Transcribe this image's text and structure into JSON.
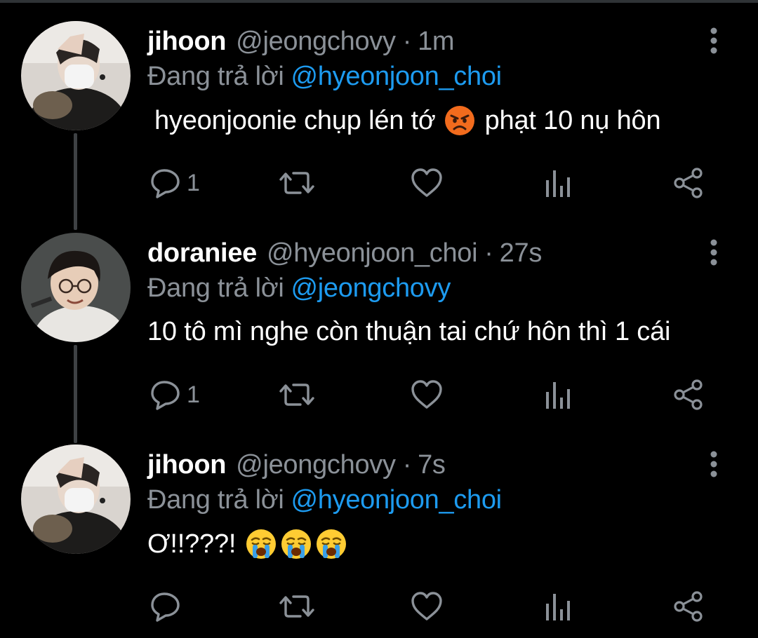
{
  "colors": {
    "background": "#000000",
    "name": "#ffffff",
    "muted": "#8b9198",
    "link": "#1d9bf0",
    "thread_line": "#3e4144"
  },
  "tweets": [
    {
      "avatar": "avatar-masked-person",
      "name": "jihoon",
      "handle": "@jeongchovy",
      "dot": "·",
      "time": "1m",
      "reply_prefix": "Đang trả lời",
      "reply_to": "@hyeonjoon_choi",
      "text_before": "hyeonjoonie chụp lén tớ",
      "emoji": [
        "angry-face-emoji"
      ],
      "text_after": "phạt 10 nụ hôn",
      "reply_count": "1",
      "icons": {
        "menu": "more-vertical-icon",
        "reply": "reply-icon",
        "retweet": "retweet-icon",
        "like": "like-icon",
        "views": "views-icon",
        "share": "share-icon"
      }
    },
    {
      "avatar": "avatar-glasses-person",
      "name": "doraniee",
      "handle": "@hyeonjoon_choi",
      "dot": "·",
      "time": "27s",
      "reply_prefix": "Đang trả lời",
      "reply_to": "@jeongchovy",
      "text_before": "10 tô mì nghe còn thuận tai chứ hôn thì 1 cái",
      "emoji": [],
      "text_after": "",
      "reply_count": "1",
      "icons": {
        "menu": "more-vertical-icon",
        "reply": "reply-icon",
        "retweet": "retweet-icon",
        "like": "like-icon",
        "views": "views-icon",
        "share": "share-icon"
      }
    },
    {
      "avatar": "avatar-masked-person",
      "name": "jihoon",
      "handle": "@jeongchovy",
      "dot": "·",
      "time": "7s",
      "reply_prefix": "Đang trả lời",
      "reply_to": "@hyeonjoon_choi",
      "text_before": "Ơ!!???!",
      "emoji": [
        "crying-face-emoji",
        "crying-face-emoji",
        "crying-face-emoji"
      ],
      "text_after": "",
      "reply_count": "",
      "icons": {
        "menu": "more-vertical-icon",
        "reply": "reply-icon",
        "retweet": "retweet-icon",
        "like": "like-icon",
        "views": "views-icon",
        "share": "share-icon"
      }
    }
  ]
}
